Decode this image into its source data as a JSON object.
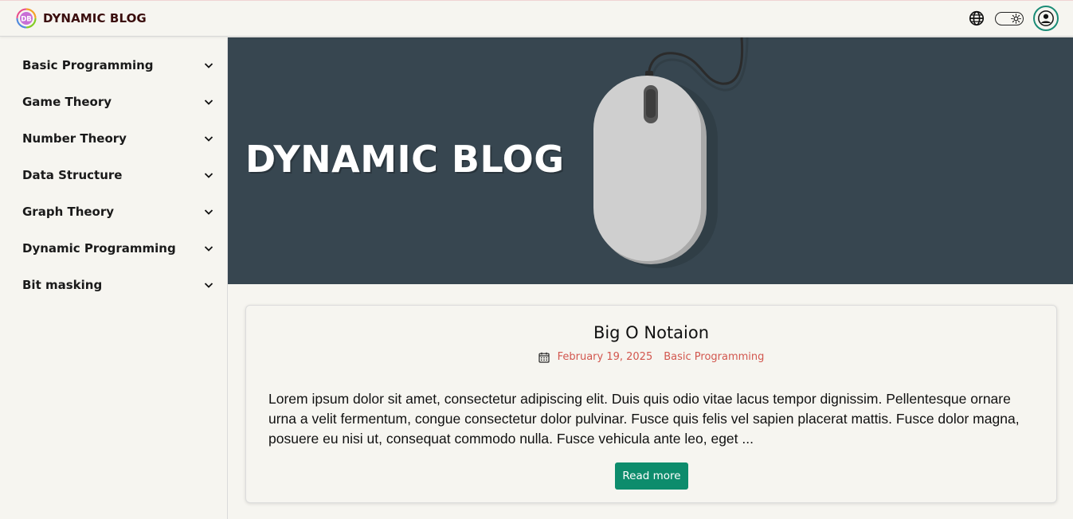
{
  "header": {
    "brand_name": "DYNAMIC BLOG",
    "logo_text": "DB",
    "icons": [
      "globe-icon",
      "theme-toggle-icon",
      "user-avatar-icon"
    ]
  },
  "sidebar": {
    "items": [
      {
        "label": "Basic Programming"
      },
      {
        "label": "Game Theory"
      },
      {
        "label": "Number Theory"
      },
      {
        "label": "Data Structure"
      },
      {
        "label": "Graph Theory"
      },
      {
        "label": "Dynamic Programming"
      },
      {
        "label": "Bit masking"
      }
    ]
  },
  "hero": {
    "title": "DYNAMIC BLOG",
    "background": "#374650"
  },
  "post": {
    "title": "Big O Notaion",
    "date": "February 19, 2025",
    "category": "Basic Programming",
    "excerpt": "Lorem ipsum dolor sit amet, consectetur adipiscing elit. Duis quis odio vitae lacus tempor dignissim. Pellentesque ornare urna a velit fermentum, congue consectetur dolor pulvinar. Fusce quis felis vel sapien placerat mattis. Fusce dolor magna, posuere eu nisi ut, consequat commodo nulla. Fusce vehicula ante leo, eget ...",
    "read_more_label": "Read more"
  },
  "colors": {
    "accent": "#0d8c6c",
    "meta": "#d2574f",
    "page_bg": "#f6f5f0"
  }
}
